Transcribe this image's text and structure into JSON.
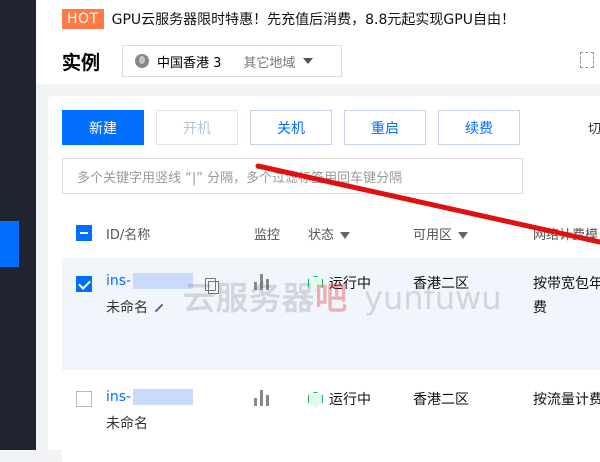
{
  "banner": {
    "hot": "HOT",
    "text": "GPU云服务器限时特惠！先充值后消费，8.8元起实现GPU自由！"
  },
  "header": {
    "title": "实例",
    "region": "中国香港 3",
    "other_regions": "其它地域"
  },
  "toolbar": {
    "buttons": [
      "新建",
      "开机",
      "关机",
      "重启",
      "续费"
    ],
    "more": "切"
  },
  "search": {
    "placeholder": "多个关键字用竖线 “|” 分隔，多个过滤标签用回车键分隔"
  },
  "table": {
    "headers": [
      "ID/名称",
      "监控",
      "状态",
      "可用区",
      "网络计费模"
    ],
    "rows": [
      {
        "id_prefix": "ins-",
        "name": "未命名",
        "status": "运行中",
        "zone": "香港二区",
        "billing": [
          "按带宽包年",
          "费"
        ],
        "selected": true
      },
      {
        "id_prefix": "ins-",
        "name": "未命名",
        "status": "运行中",
        "zone": "香港二区",
        "billing": [
          "按流量计费"
        ],
        "selected": false
      }
    ]
  },
  "watermark": {
    "cn": "云服务器",
    "accent": "吧",
    "en": "yunfuwu"
  },
  "colors": {
    "primary": "#006eff",
    "hot": "#ff7a45",
    "sidebar": "#1f2430",
    "running": "#0abf5b",
    "annotation_line": "#e01010"
  }
}
